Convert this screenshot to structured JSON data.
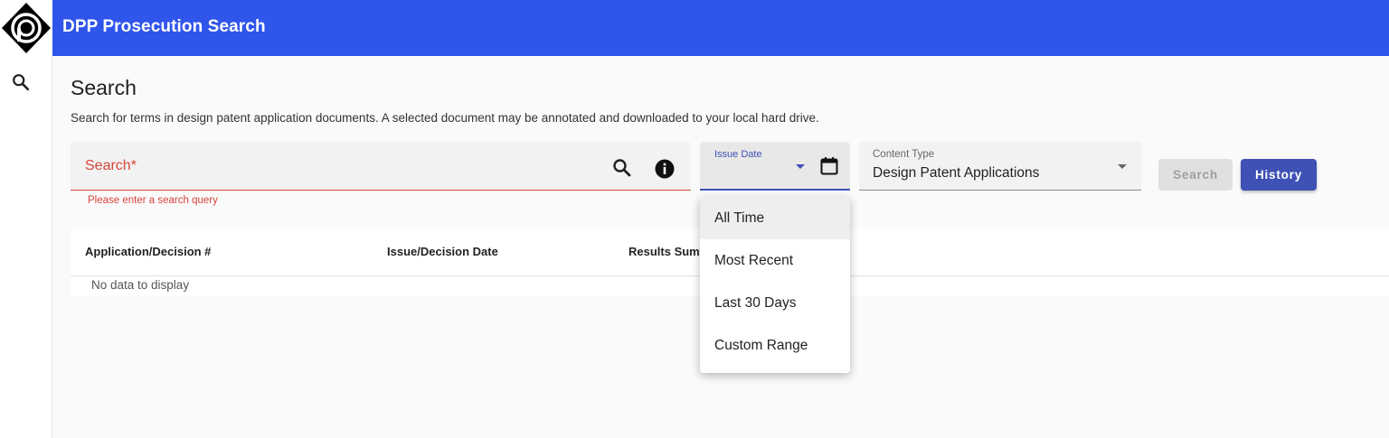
{
  "header": {
    "app_title": "DPP Prosecution Search",
    "logo_icon": "dpp-logo",
    "background_color": "#2f55eb"
  },
  "sidebar": {
    "icon": "search-icon"
  },
  "page": {
    "title": "Search",
    "description": "Search for terms in design patent application documents. A selected document may be annotated and downloaded to your local hard drive."
  },
  "search": {
    "label": "Search*",
    "value": "",
    "error": "Please enter a search query",
    "search_icon": "search-icon",
    "info_icon": "info-icon"
  },
  "issue_date": {
    "label": "Issue Date",
    "value": "",
    "calendar_icon": "calendar-icon",
    "options": [
      "All Time",
      "Most Recent",
      "Last 30 Days",
      "Custom Range"
    ],
    "highlighted": "All Time"
  },
  "content_type": {
    "label": "Content Type",
    "value": "Design Patent Applications"
  },
  "buttons": {
    "search": "Search",
    "history": "History"
  },
  "table": {
    "columns": [
      "Application/Decision #",
      "Issue/Decision Date",
      "Results Sum"
    ],
    "empty_message": "No data to display"
  },
  "colors": {
    "accent": "#3f51b5",
    "error": "#d9453c"
  }
}
